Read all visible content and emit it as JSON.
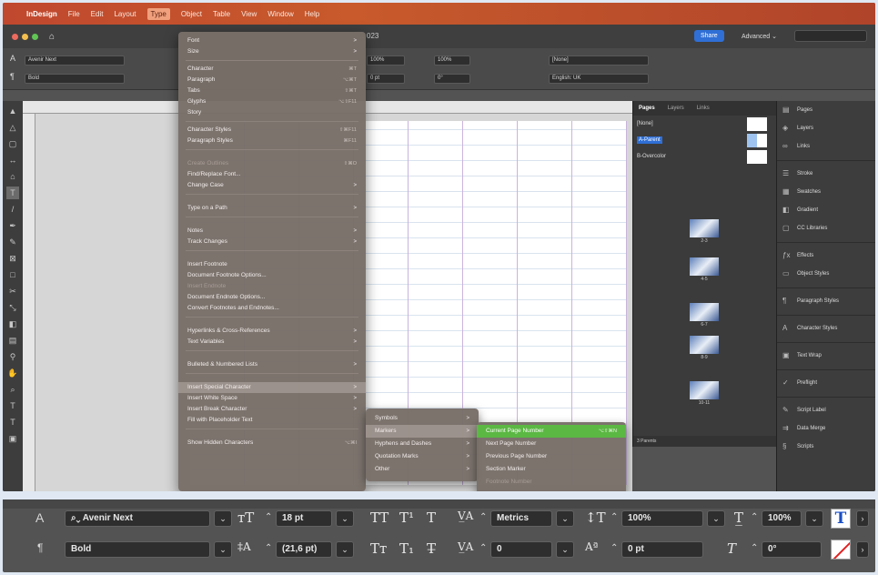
{
  "menubar": {
    "app_name": "InDesign",
    "items": [
      "File",
      "Edit",
      "Layout",
      "Type",
      "Object",
      "Table",
      "View",
      "Window",
      "Help"
    ],
    "active": "Type"
  },
  "titlebar": {
    "doc_tab": "…023",
    "share_label": "Share",
    "workspace_label": "Advanced ⌄"
  },
  "type_menu": {
    "groups": [
      [
        {
          "label": "Font",
          "arrow": ">"
        },
        {
          "label": "Size",
          "arrow": ">"
        }
      ],
      [
        {
          "label": "Character",
          "shortcut": "⌘T"
        },
        {
          "label": "Paragraph",
          "shortcut": "⌥⌘T"
        },
        {
          "label": "Tabs",
          "shortcut": "⇧⌘T"
        },
        {
          "label": "Glyphs",
          "shortcut": "⌥⇧F11"
        },
        {
          "label": "Story"
        }
      ],
      [
        {
          "label": "Character Styles",
          "shortcut": "⇧⌘F11"
        },
        {
          "label": "Paragraph Styles",
          "shortcut": "⌘F11"
        }
      ],
      [
        {
          "label": "Create Outlines",
          "shortcut": "⇧⌘O",
          "disabled": true
        },
        {
          "label": "Find/Replace Font..."
        },
        {
          "label": "Change Case",
          "arrow": ">"
        }
      ],
      [
        {
          "label": "Type on a Path",
          "arrow": ">"
        }
      ],
      [
        {
          "label": "Notes",
          "arrow": ">"
        },
        {
          "label": "Track Changes",
          "arrow": ">"
        }
      ],
      [
        {
          "label": "Insert Footnote"
        },
        {
          "label": "Document Footnote Options..."
        },
        {
          "label": "Insert Endnote",
          "disabled": true
        },
        {
          "label": "Document Endnote Options..."
        },
        {
          "label": "Convert Footnotes and Endnotes..."
        }
      ],
      [
        {
          "label": "Hyperlinks & Cross-References",
          "arrow": ">"
        },
        {
          "label": "Text Variables",
          "arrow": ">"
        }
      ],
      [
        {
          "label": "Bulleted & Numbered Lists",
          "arrow": ">"
        }
      ],
      [
        {
          "label": "Insert Special Character",
          "arrow": ">",
          "highlighted": true
        },
        {
          "label": "Insert White Space",
          "arrow": ">"
        },
        {
          "label": "Insert Break Character",
          "arrow": ">"
        },
        {
          "label": "Fill with Placeholder Text"
        }
      ],
      [
        {
          "label": "Show Hidden Characters",
          "shortcut": "⌥⌘I"
        }
      ]
    ]
  },
  "special_char_submenu": [
    {
      "label": "Symbols",
      "arrow": ">"
    },
    {
      "label": "Markers",
      "arrow": ">",
      "highlighted": true
    },
    {
      "label": "Hyphens and Dashes",
      "arrow": ">"
    },
    {
      "label": "Quotation Marks",
      "arrow": ">"
    },
    {
      "label": "Other",
      "arrow": ">"
    }
  ],
  "markers_submenu": [
    {
      "label": "Current Page Number",
      "shortcut": "⌥⇧⌘N",
      "selected": true
    },
    {
      "label": "Next Page Number"
    },
    {
      "label": "Previous Page Number"
    },
    {
      "label": "Section Marker"
    },
    {
      "label": "Footnote Number",
      "disabled": true
    }
  ],
  "pages_panel": {
    "tabs": [
      "Pages",
      "Layers",
      "Links"
    ],
    "masters": [
      "[None]",
      "A-Parent",
      "B-Overcolor"
    ],
    "spreads": [
      "2-3",
      "4-5",
      "6-7",
      "8-9",
      "10-11"
    ],
    "footer": "3 Parents"
  },
  "dock": {
    "items": [
      "Pages",
      "Layers",
      "Links",
      "Stroke",
      "Swatches",
      "Gradient",
      "CC Libraries",
      "Effects",
      "Object Styles",
      "Paragraph Styles",
      "Character Styles",
      "Text Wrap",
      "Preflight",
      "Script Label",
      "Data Merge",
      "Scripts"
    ]
  },
  "control_panel": {
    "font_family": "Avenir Next",
    "font_style": "Bold",
    "font_size": "18 pt",
    "leading": "(21,6 pt)",
    "kerning": "Metrics",
    "tracking": "0",
    "vertical_scale": "100%",
    "horizontal_scale": "100%",
    "baseline_shift": "0 pt",
    "skew": "0°",
    "language": "English: UK",
    "char_style": "[None]"
  },
  "colors": {
    "menubar_gradient_start": "#c0482e",
    "selection_green": "#5bb843",
    "fill_blue": "#1a4fc4",
    "stroke_red": "#e02020"
  }
}
